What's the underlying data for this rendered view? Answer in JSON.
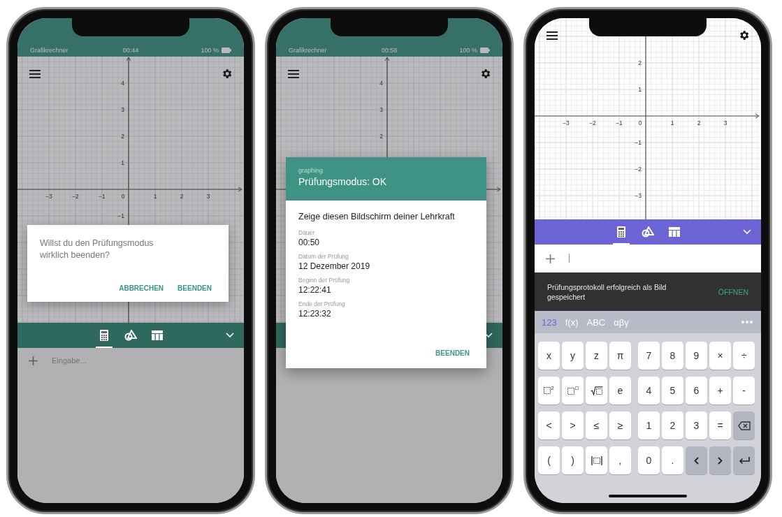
{
  "phones": [
    {
      "status_bar": {
        "app": "Grafikrechner",
        "time": "00:44",
        "battery": "100 %"
      },
      "dimmed": true,
      "graph": {
        "x_labels": [
          "−3",
          "−2",
          "−1",
          "0",
          "1",
          "2",
          "3"
        ],
        "y_labels_positive": [
          "4",
          "3",
          "2",
          "1"
        ],
        "y_labels_negative": [
          "−1"
        ]
      },
      "toolbar": {
        "color": "#2f685d",
        "tabs": [
          {
            "kind": "calculator",
            "selected": true
          },
          {
            "kind": "shapes",
            "selected": false
          },
          {
            "kind": "table",
            "selected": false
          }
        ]
      },
      "input": {
        "placeholder": "Eingabe...",
        "focused": false
      },
      "confirm_dialog": {
        "message": "Willst du den Prüfungsmodus wirklich beenden?",
        "buttons": [
          "ABBRECHEN",
          "BEENDEN"
        ]
      }
    },
    {
      "status_bar": {
        "app": "Grafikrechner",
        "time": "00:58",
        "battery": "100 %"
      },
      "dimmed": true,
      "graph": {
        "y_labels_positive": [
          "4",
          "3",
          "2"
        ]
      },
      "toolbar": {
        "color": "#2f685d"
      },
      "exam_dialog": {
        "subtitle": "graphing",
        "title": "Prüfungsmodus: OK",
        "heading": "Zeige diesen Bildschirm deiner Lehrkraft",
        "fields": [
          {
            "label": "Dauer",
            "value": "00:50"
          },
          {
            "label": "Datum der Prüfung",
            "value": "12 Dezember 2019"
          },
          {
            "label": "Beginn der Prüfung",
            "value": "12:22:41"
          },
          {
            "label": "Ende der Prüfung",
            "value": "12:23:32"
          }
        ],
        "button": "BEENDEN"
      }
    },
    {
      "dimmed": false,
      "graph": {
        "x_labels": [
          "−3",
          "−2",
          "−1",
          "0",
          "1",
          "2",
          "3"
        ],
        "y_labels_positive": [
          "2",
          "1"
        ],
        "y_labels_negative": [
          "−1",
          "−2",
          "−3"
        ]
      },
      "toolbar": {
        "color": "#6c63d4",
        "tabs": [
          {
            "kind": "calculator",
            "selected": true
          },
          {
            "kind": "shapes",
            "selected": false
          },
          {
            "kind": "table",
            "selected": false
          }
        ]
      },
      "input": {
        "focused": true
      },
      "snackbar": {
        "message": "Prüfungsprotokoll erfolgreich als Bild gespeichert",
        "action": "ÖFFNEN"
      },
      "keyboard": {
        "tabs": [
          {
            "label": "123",
            "selected": true
          },
          {
            "label": "f(x)",
            "selected": false
          },
          {
            "label": "ABC",
            "selected": false
          },
          {
            "label": "αβγ",
            "selected": false
          }
        ],
        "rows": [
          [
            {
              "kind": "char",
              "label": "x"
            },
            {
              "kind": "char",
              "label": "y"
            },
            {
              "kind": "char",
              "label": "z"
            },
            {
              "kind": "char",
              "label": "π"
            },
            {
              "kind": "char",
              "label": "7"
            },
            {
              "kind": "char",
              "label": "8"
            },
            {
              "kind": "char",
              "label": "9"
            },
            {
              "kind": "char",
              "label": "×"
            },
            {
              "kind": "char",
              "label": "÷"
            }
          ],
          [
            {
              "kind": "square",
              "label": "2"
            },
            {
              "kind": "power"
            },
            {
              "kind": "sqrt"
            },
            {
              "kind": "char",
              "label": "e"
            },
            {
              "kind": "char",
              "label": "4"
            },
            {
              "kind": "char",
              "label": "5"
            },
            {
              "kind": "char",
              "label": "6"
            },
            {
              "kind": "char",
              "label": "+"
            },
            {
              "kind": "char",
              "label": "-"
            }
          ],
          [
            {
              "kind": "char",
              "label": "<"
            },
            {
              "kind": "char",
              "label": ">"
            },
            {
              "kind": "char",
              "label": "≤"
            },
            {
              "kind": "char",
              "label": "≥"
            },
            {
              "kind": "char",
              "label": "1"
            },
            {
              "kind": "char",
              "label": "2"
            },
            {
              "kind": "char",
              "label": "3"
            },
            {
              "kind": "char",
              "label": "="
            },
            {
              "kind": "backspace"
            }
          ],
          [
            {
              "kind": "char",
              "label": "("
            },
            {
              "kind": "char",
              "label": ")"
            },
            {
              "kind": "abs"
            },
            {
              "kind": "char",
              "label": ","
            },
            {
              "kind": "char",
              "label": "0"
            },
            {
              "kind": "char",
              "label": "."
            },
            {
              "kind": "left"
            },
            {
              "kind": "right"
            },
            {
              "kind": "enter"
            }
          ]
        ]
      }
    }
  ]
}
